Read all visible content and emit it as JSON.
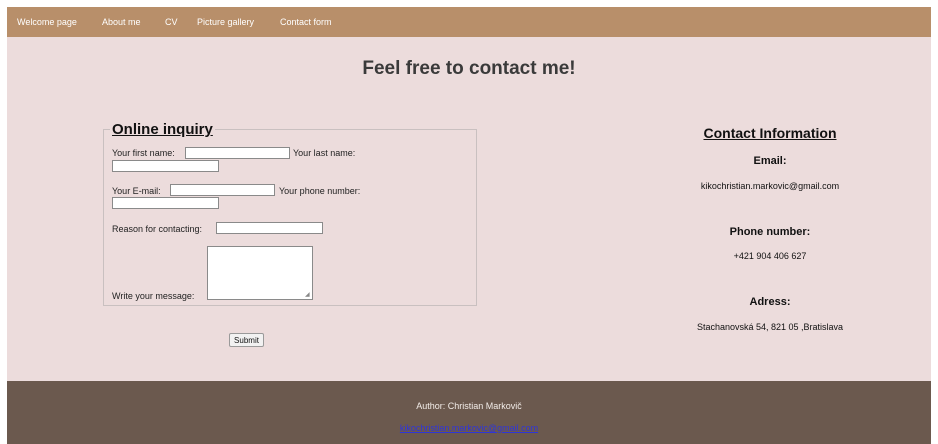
{
  "nav": {
    "items": [
      "Welcome page",
      "About me",
      "CV",
      "Picture gallery",
      "Contact form"
    ]
  },
  "page": {
    "title": "Feel free to contact me!"
  },
  "form": {
    "legend": "Online inquiry",
    "first_name_label": "Your first name:",
    "last_name_label": "Your last name:",
    "email_label": "Your E-mail:",
    "phone_label": "Your phone number:",
    "reason_label": "Reason for contacting:",
    "message_label": "Write your message:",
    "first_name_value": "",
    "last_name_value": "",
    "email_value": "",
    "phone_value": "",
    "reason_value": "",
    "message_value": "",
    "submit_label": "Submit"
  },
  "contact": {
    "heading": "Contact Information",
    "email_label": "Email:",
    "email_value": "kikochristian.markovic@gmail.com",
    "phone_label": "Phone number:",
    "phone_value": "+421 904 406 627",
    "address_label": "Adress:",
    "address_value": "Stachanovská 54, 821 05 ,Bratislava"
  },
  "footer": {
    "author": "Author: Christian Markovič",
    "email_link": "kikochristian.markovic@gmail.com"
  },
  "colors": {
    "nav_bg": "#b88f6a",
    "page_bg": "#ecdcdc",
    "footer_bg": "#6b594e",
    "link": "#2f35d8"
  }
}
